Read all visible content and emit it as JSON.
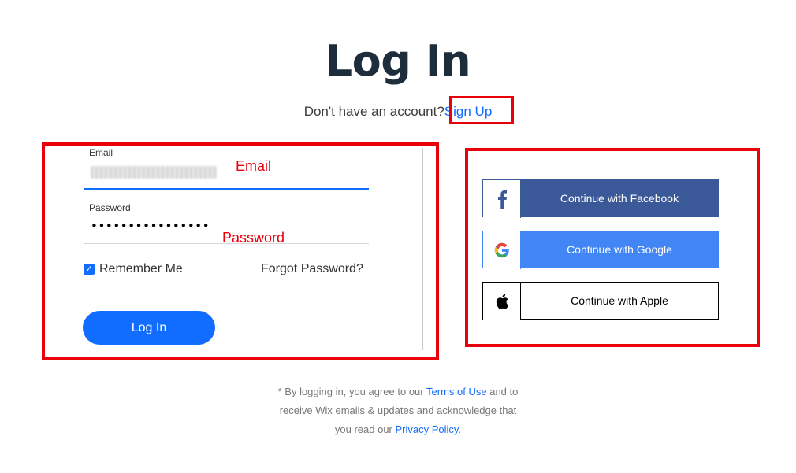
{
  "page": {
    "title": "Log In",
    "subtitle_prefix": "Don't have an account?",
    "signup_link": "Sign Up"
  },
  "form": {
    "email_label": "Email",
    "password_label": "Password",
    "password_value": "••••••••••••••••",
    "remember_label": "Remember Me",
    "remember_checked": true,
    "forgot_label": "Forgot Password?",
    "login_button": "Log In"
  },
  "annotations": {
    "email": "Email",
    "password": "Password"
  },
  "social": {
    "facebook_label": "Continue with Facebook",
    "google_label": "Continue with Google",
    "apple_label": "Continue with Apple"
  },
  "footer": {
    "line1_prefix": "* By logging in, you agree to our",
    "terms_link": "Terms of Use",
    "line1_suffix": "and to",
    "line2": "receive Wix emails & updates and acknowledge that",
    "line3_prefix": "you read our",
    "privacy_link": "Privacy Policy",
    "line3_suffix": "."
  },
  "colors": {
    "accent": "#116dff",
    "annotation_red": "#e8000b",
    "facebook": "#3b5998",
    "google": "#4285f4"
  }
}
